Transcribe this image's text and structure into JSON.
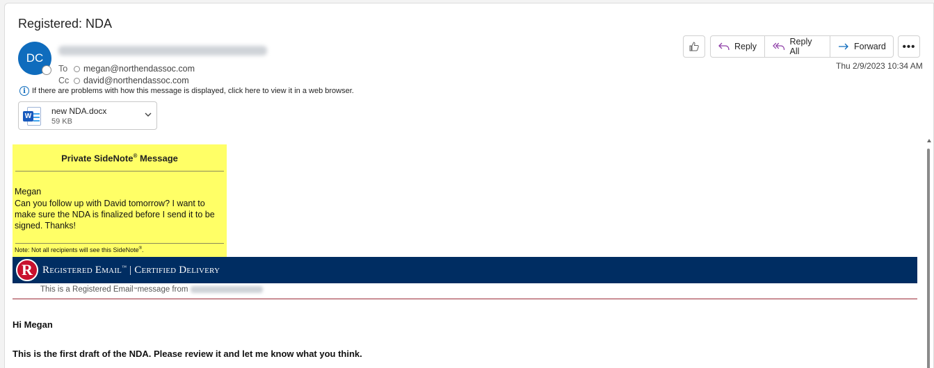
{
  "message": {
    "subject": "Registered: NDA",
    "sender_initials": "DC",
    "recipients": {
      "to_label": "To",
      "to": "megan@northendassoc.com",
      "cc_label": "Cc",
      "cc": "david@northendassoc.com"
    },
    "info_notice": "If there are problems with how this message is displayed, click here to view it in a web browser.",
    "datetime": "Thu 2/9/2023 10:34 AM"
  },
  "attachment": {
    "name": "new NDA.docx",
    "size": "59 KB",
    "icon": "word-document-icon"
  },
  "toolbar": {
    "reply": "Reply",
    "reply_all": "Reply All",
    "forward": "Forward",
    "more": "•••"
  },
  "sidenote": {
    "title": "Private SideNote",
    "title_mark": "®",
    "title_suffix": " Message",
    "to": "Megan",
    "body": "Can you follow up with David tomorrow? I want to make sure the NDA is finalized before I send it to be signed. Thanks!",
    "note": "Note: Not all recipients will see this SideNote",
    "note_mark": "®",
    "note_end": "."
  },
  "registered": {
    "logo_letter": "R",
    "brand": "Registered Email",
    "brand_mark": "™",
    "tagline": " | Certified Delivery",
    "sub_prefix": "This is a Registered Email",
    "sub_mark": "™",
    "sub_suffix": " message from"
  },
  "body": {
    "greeting": "Hi Megan",
    "line1": "This is the first draft of the NDA. Please review it and let me know what you think."
  },
  "colors": {
    "accent": "#0f6cbd",
    "sidenote_bg": "#ffff66",
    "registered_bar": "#002d62",
    "registered_logo": "#c8102e",
    "reply_all_icon": "#8f3fa8"
  }
}
